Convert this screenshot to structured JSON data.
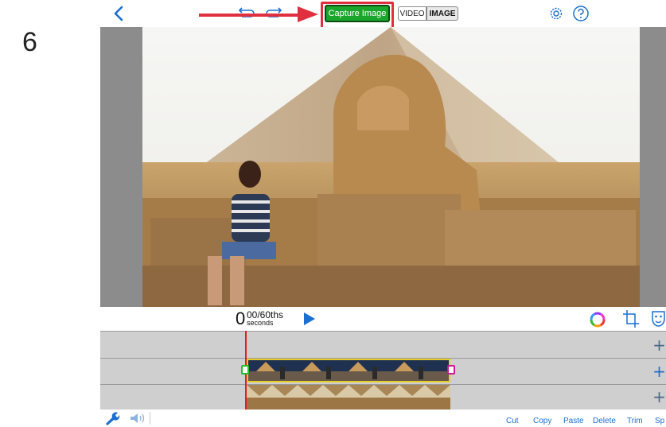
{
  "step_number": "6",
  "toolbar": {
    "capture_label": "Capture Image",
    "mode_video": "VIDEO",
    "mode_image": "IMAGE"
  },
  "transport": {
    "time_value": "0",
    "time_fraction": "00/60ths",
    "time_unit": "seconds"
  },
  "tracks": {
    "add_symbol": "+"
  },
  "bottom_actions": [
    "Cut",
    "Copy",
    "Paste",
    "Delete",
    "Trim",
    "Sp"
  ],
  "colors": {
    "capture_green": "#1aa52b",
    "highlight_red": "#e03040",
    "accent_blue": "#1a6fd0",
    "clip_border": "#e6cf2a",
    "playhead_red": "#e02020"
  },
  "icons": [
    "back-icon",
    "undo-icon",
    "redo-icon",
    "gear-icon",
    "help-icon",
    "play-icon",
    "color-wheel-icon",
    "crop-icon",
    "mask-icon",
    "wrench-icon",
    "speaker-icon"
  ]
}
